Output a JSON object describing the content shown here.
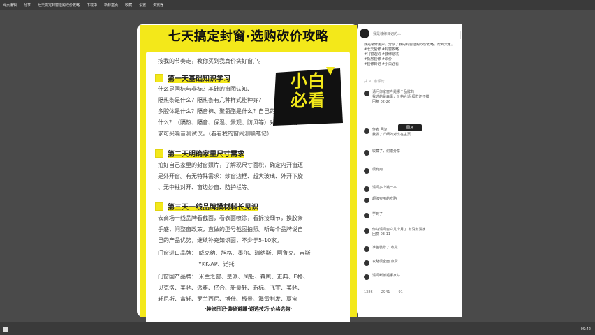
{
  "topbar": {
    "items": [
      "网页编辑",
      "分享",
      "七天搞定封窗选购砍价攻略",
      "下载中",
      "新标签页",
      "收藏",
      "设置",
      "浏览器"
    ]
  },
  "bottombar": {
    "time": "09:42"
  },
  "poster": {
    "title": "七天搞定封窗·选购砍价攻略",
    "intro": "按我的节奏走，教你买到我真价实好窗户。",
    "badge_line1": "小白",
    "badge_line2": "必看",
    "sections": [
      {
        "heading": "第一天基础知识学习",
        "lines": [
          "什么是国标与非标？基础的窗图认知、",
          "隔热条是什么？隔热条有几种样式能种好？",
          "多腔体是什么？隔音棉、聚氨酯是什么？自己的封窗需求是",
          "什么？（隔热、隔音、保温、景观、防风等）对静音有需",
          "求可买噪音测试仪。（看看我的窗间测噪笔记）"
        ]
      },
      {
        "heading": "第二天明确家里尺寸需求",
        "lines": [
          "拍好自己家里的封窗照片，了解现尺寸面积，确定内开窗还",
          "是外开窗。有无特殊需求：纱窗边框、超大玻璃、外开下旋",
          "、无中柱对开、窗边妙窗、防护栏等。"
        ]
      },
      {
        "heading": "第三天一线品牌摸材料长见识",
        "lines": [
          "去商场一线品牌看截面，看表面喷涂，看拆接细节，摸胶条",
          "手感，问整窗政策，直做的型号截图拍照。听每个品牌说自",
          "己的产品优势，继续补充知识面，不少于5-10家。",
          "门窗进口品牌：   威克纳、旭格、墨尔、瑞纳斯、阿鲁克、吉斯",
          "YKK-AP、诺托",
          "门窗国产品牌：   米兰之窗、皇派、凤铝、森鹰、正典、E格、",
          "贝克洛、美驰、派雅、亿合、新豪轩、新标、飞宇、美驰、",
          "轩尼斯、富轩、罗兰西尼、博仕、极景、瀑雷利发、夏宝"
        ]
      }
    ],
    "footer": "·装修日记·装修避雕·避选技巧·价格选购·"
  },
  "panel": {
    "author": "我是装修日记的人",
    "desc": [
      "我是装修用户，分享了我的封窗选购砍价攻略，帮到大家。",
      "#七天装修 #封窗攻略",
      "#门窗选购 #装修避坑",
      "#新房装修 #砍价",
      "#装修日记 #小白必看"
    ],
    "comment_count": "共 91 条评论",
    "comments": [
      {
        "lines": [
          "请问你家窗户是哪个品牌的",
          "我选的是森鹰，价格合适 细节还不错",
          "回复 02-26"
        ]
      },
      {
        "lines": [
          "作者 回复",
          "我发了详细的对比在主页"
        ]
      },
      {
        "lines": [
          "收藏了，谢谢分享"
        ]
      },
      {
        "lines": [
          "很有用"
        ]
      },
      {
        "lines": [
          "请问多少钱一平"
        ]
      },
      {
        "lines": [
          "超级实用的攻略"
        ]
      },
      {
        "lines": [
          "学到了"
        ]
      },
      {
        "lines": [
          "你好请问窗户几个月了 有没有漏水",
          "回复 03-11"
        ]
      },
      {
        "lines": [
          "准备装修了 收藏"
        ]
      },
      {
        "lines": [
          "攻略很全面 点赞"
        ]
      },
      {
        "lines": [
          "请问断桥铝哪家好"
        ]
      }
    ],
    "tooltip": "回复",
    "actions": [
      "1386",
      "2941",
      "91"
    ]
  }
}
